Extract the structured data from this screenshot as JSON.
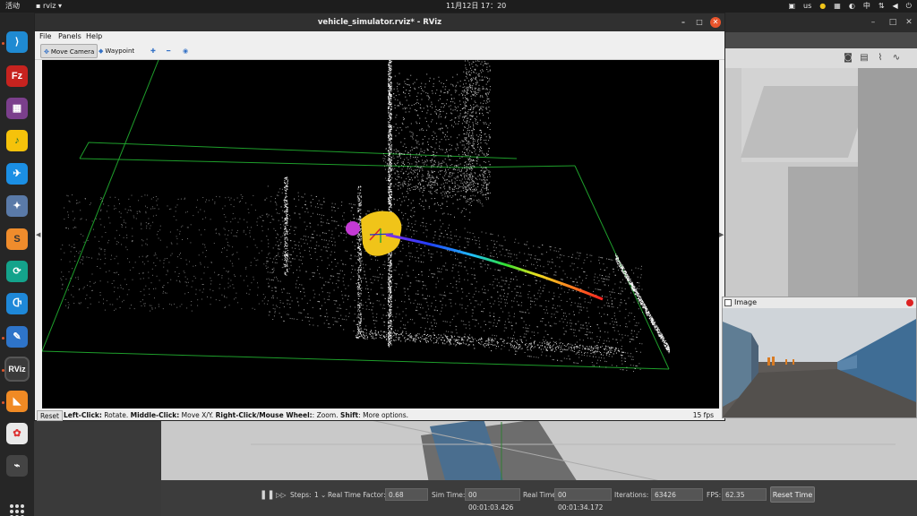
{
  "topbar": {
    "activities": "活动",
    "app_name": "rviz",
    "clock": "11月12日  17：20",
    "keyboard_layout": "us",
    "input_method": "中"
  },
  "dock": {
    "items": [
      {
        "icon": "vscode-icon",
        "glyph": "⟩",
        "color": "#1f8ad2"
      },
      {
        "icon": "filezilla-icon",
        "glyph": "Fz",
        "color": "#c7231f"
      },
      {
        "icon": "film-icon",
        "glyph": "▦",
        "color": "#7b3f8c"
      },
      {
        "icon": "music-player-icon",
        "glyph": "♪",
        "color": "#f6c20b"
      },
      {
        "icon": "feishu-icon",
        "glyph": "✈",
        "color": "#1b8fe4"
      },
      {
        "icon": "rocket-icon",
        "glyph": "✦",
        "color": "#5a7aa8"
      },
      {
        "icon": "sublime-text-icon",
        "glyph": "S",
        "color": "#ef8c2c"
      },
      {
        "icon": "sync-icon",
        "glyph": "⟳",
        "color": "#14a38b"
      },
      {
        "icon": "app-store-icon",
        "glyph": "Ⴇ",
        "color": "#1e88d8"
      },
      {
        "icon": "text-editor-icon",
        "glyph": "✎",
        "color": "#2e74c9"
      },
      {
        "icon": "rviz-icon",
        "glyph": "RViz",
        "color": "#3a3a3a"
      },
      {
        "icon": "gazebo-icon",
        "glyph": "◣",
        "color": "#f08a24"
      },
      {
        "icon": "color-picker-icon",
        "glyph": "✿",
        "color": "#e9e9e9"
      },
      {
        "icon": "usb-icon",
        "glyph": "⌁",
        "color": "#444"
      }
    ]
  },
  "rviz": {
    "title": "vehicle_simulator.rviz* - RViz",
    "menu": [
      "File",
      "Panels",
      "Help"
    ],
    "tools": {
      "move_camera": "Move Camera",
      "waypoint": "Waypoint"
    },
    "status": {
      "reset": "Reset",
      "left_click_label": "Left-Click:",
      "left_click_text": " Rotate. ",
      "middle_click_label": "Middle-Click:",
      "middle_click_text": " Move X/Y. ",
      "right_click_label": "Right-Click/Mouse Wheel:",
      "right_click_text": ": Zoom. ",
      "shift_label": "Shift",
      "shift_text": ": More options.",
      "fps": "15 fps"
    }
  },
  "image_panel": {
    "title": "Image"
  },
  "gazebo": {
    "steps_label": "Steps:",
    "steps_value": "1",
    "rtf_label": "Real Time Factor:",
    "rtf_value": "0.68",
    "sim_time_label": "Sim Time:",
    "sim_time_value": "00 00:01:03.426",
    "real_time_label": "Real Time:",
    "real_time_value": "00 00:01:34.172",
    "iterations_label": "Iterations:",
    "iterations_value": "63426",
    "fps_label": "FPS:",
    "fps_value": "62.35",
    "reset_time": "Reset Time"
  }
}
